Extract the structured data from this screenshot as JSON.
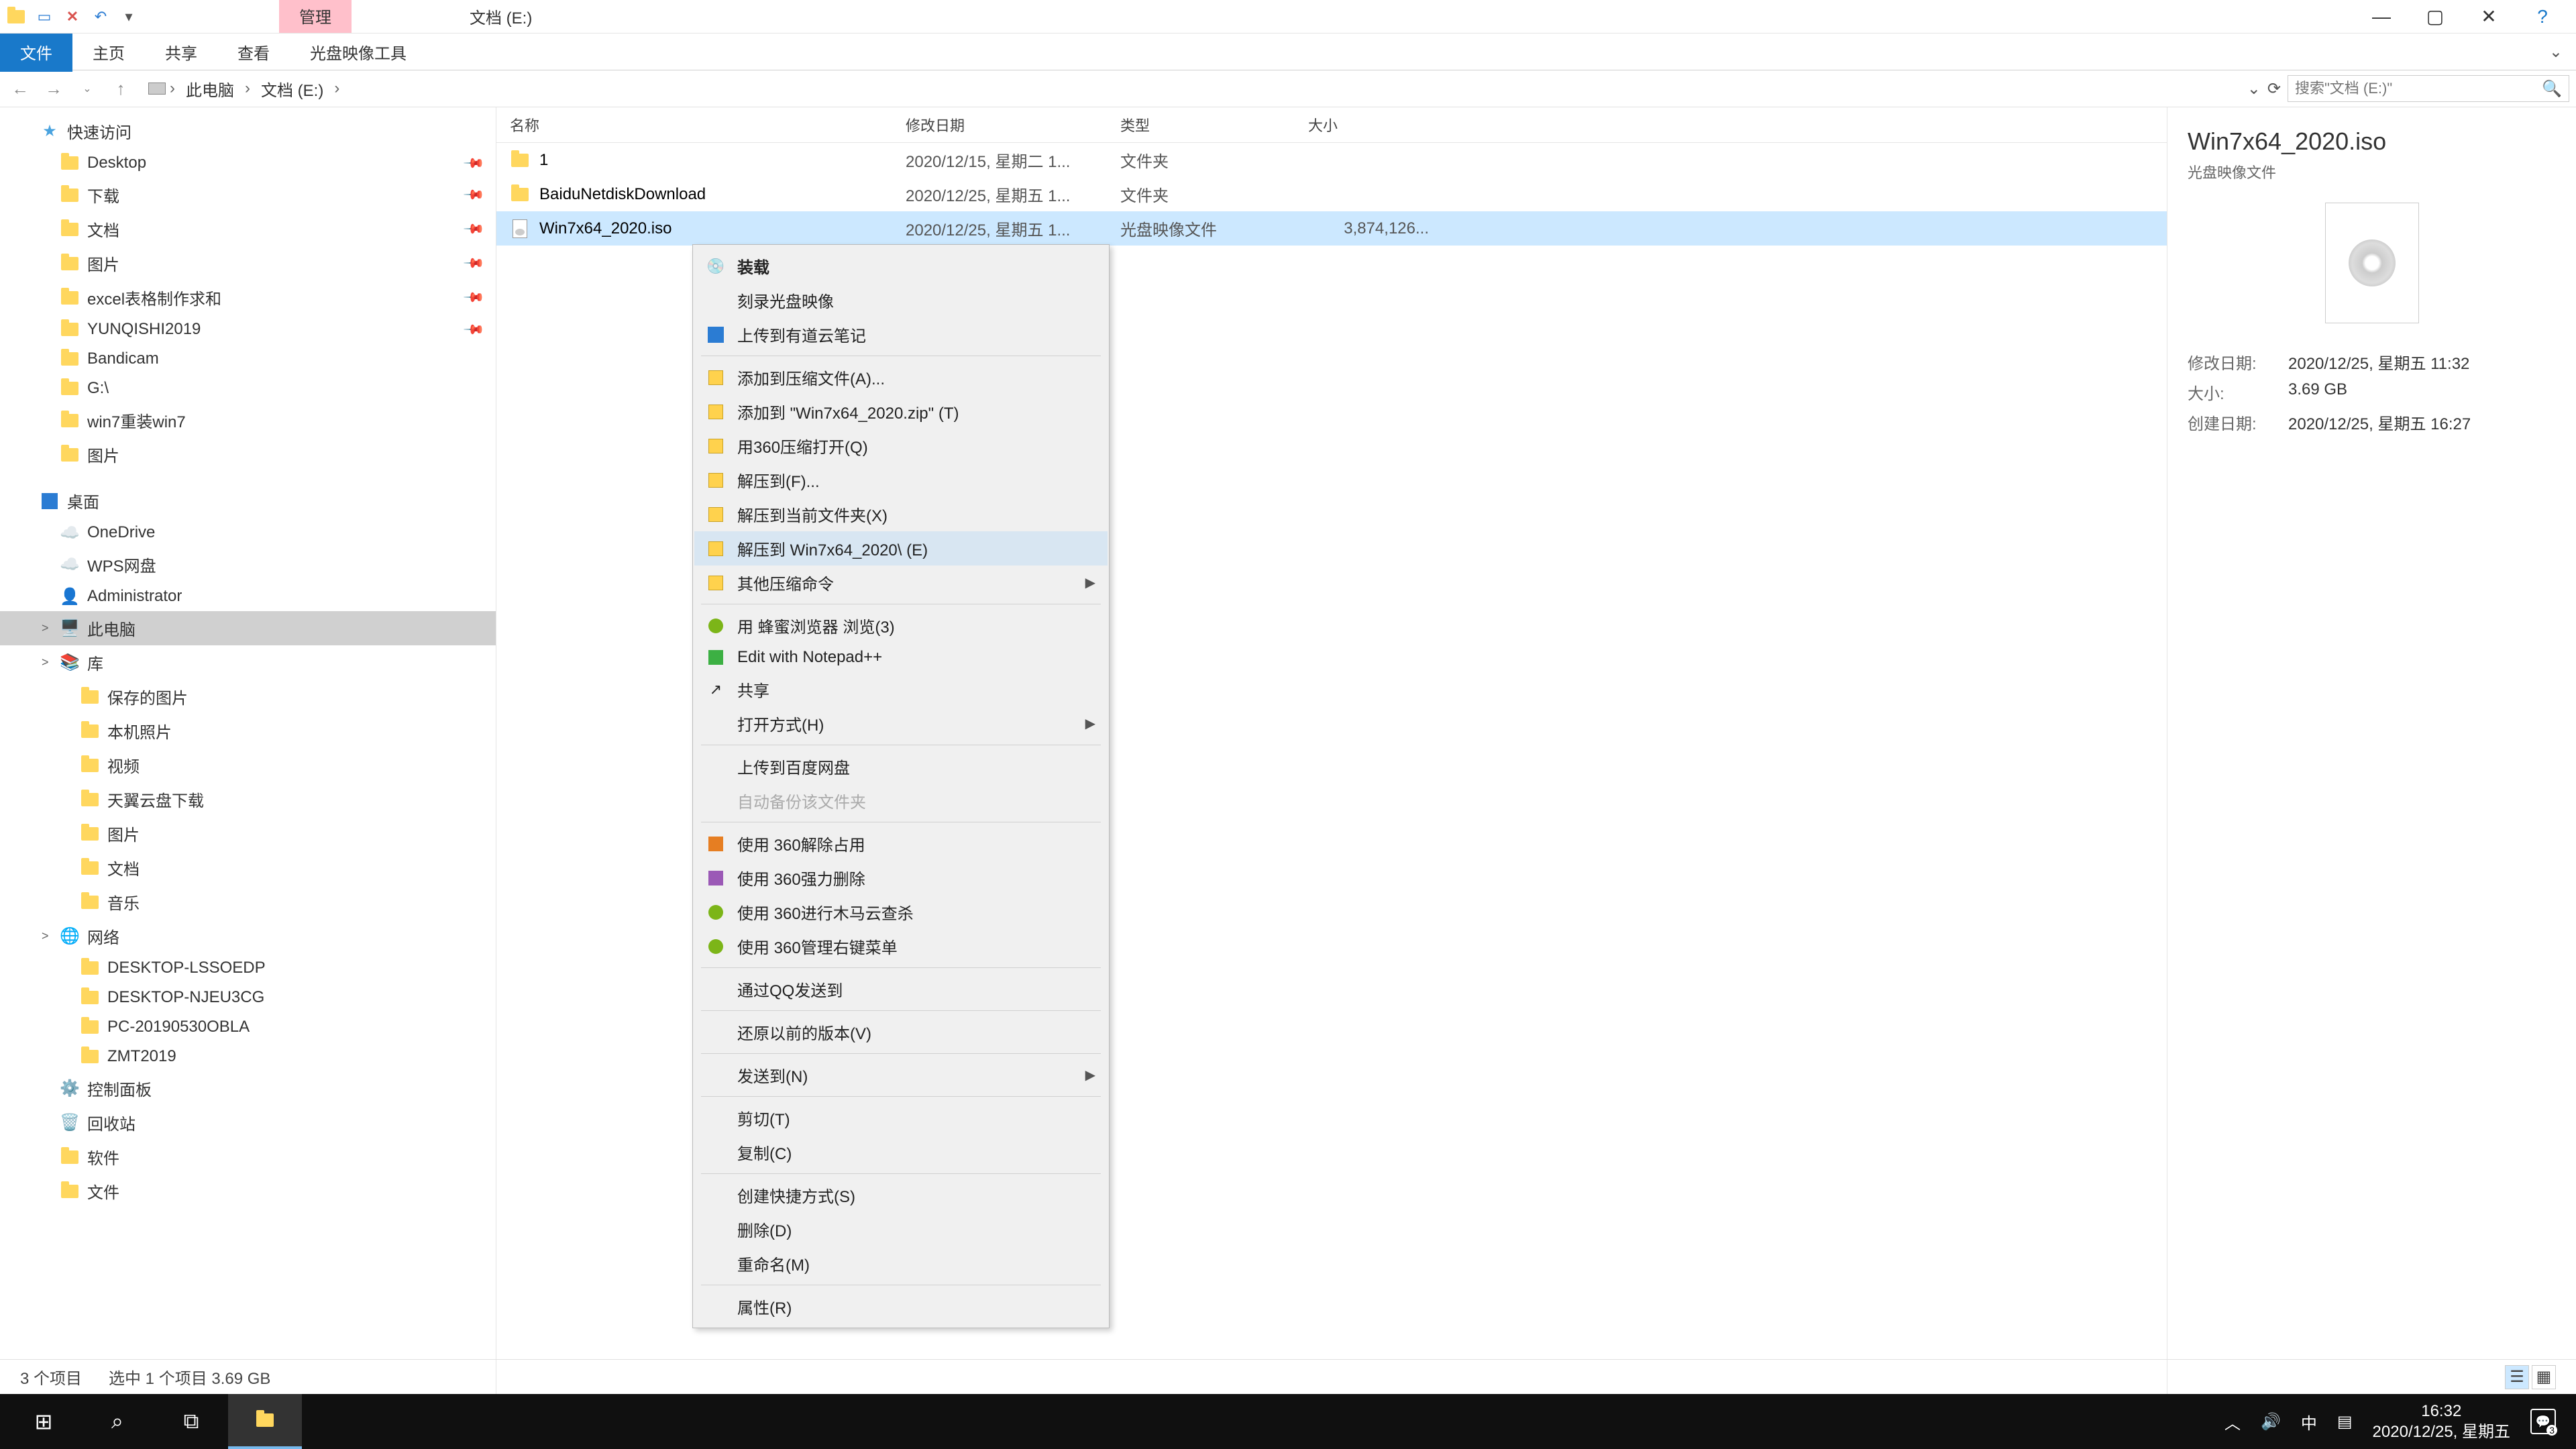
{
  "window": {
    "title": "文档 (E:)"
  },
  "ribbon_top": {
    "manage": "管理"
  },
  "ribbon": {
    "file": "文件",
    "home": "主页",
    "share": "共享",
    "view": "查看",
    "disc_tools": "光盘映像工具"
  },
  "breadcrumb": {
    "root": "此电脑",
    "current": "文档 (E:)"
  },
  "search": {
    "placeholder": "搜索\"文档 (E:)\""
  },
  "tree": {
    "quick_access": "快速访问",
    "items_qa": [
      "Desktop",
      "下载",
      "文档",
      "图片",
      "excel表格制作求和",
      "YUNQISHI2019",
      "Bandicam",
      "G:\\",
      "win7重装win7",
      "图片"
    ],
    "desktop_section": "桌面",
    "desktop_items": [
      "OneDrive",
      "WPS网盘",
      "Administrator",
      "此电脑",
      "库",
      "保存的图片",
      "本机照片",
      "视频",
      "天翼云盘下载",
      "图片",
      "文档",
      "音乐",
      "网络",
      "DESKTOP-LSSOEDP",
      "DESKTOP-NJEU3CG",
      "PC-20190530OBLA",
      "ZMT2019",
      "控制面板",
      "回收站",
      "软件",
      "文件"
    ]
  },
  "columns": {
    "name": "名称",
    "date": "修改日期",
    "type": "类型",
    "size": "大小"
  },
  "files": [
    {
      "name": "1",
      "date": "2020/12/15, 星期二 1...",
      "type": "文件夹",
      "size": "",
      "kind": "folder"
    },
    {
      "name": "BaiduNetdiskDownload",
      "date": "2020/12/25, 星期五 1...",
      "type": "文件夹",
      "size": "",
      "kind": "folder"
    },
    {
      "name": "Win7x64_2020.iso",
      "date": "2020/12/25, 星期五 1...",
      "type": "光盘映像文件",
      "size": "3,874,126...",
      "kind": "iso"
    }
  ],
  "context_menu": [
    {
      "label": "装载",
      "icon": "disc",
      "bold": true
    },
    {
      "label": "刻录光盘映像"
    },
    {
      "label": "上传到有道云笔记",
      "icon": "blue"
    },
    {
      "sep": true
    },
    {
      "label": "添加到压缩文件(A)...",
      "icon": "yellow"
    },
    {
      "label": "添加到 \"Win7x64_2020.zip\" (T)",
      "icon": "yellow"
    },
    {
      "label": "用360压缩打开(Q)",
      "icon": "yellow"
    },
    {
      "label": "解压到(F)...",
      "icon": "yellow"
    },
    {
      "label": "解压到当前文件夹(X)",
      "icon": "yellow"
    },
    {
      "label": "解压到 Win7x64_2020\\ (E)",
      "icon": "yellow",
      "hover": true
    },
    {
      "label": "其他压缩命令",
      "icon": "yellow",
      "submenu": true
    },
    {
      "sep": true
    },
    {
      "label": "用 蜂蜜浏览器 浏览(3)",
      "icon": "green-ci"
    },
    {
      "label": "Edit with Notepad++",
      "icon": "green-sq"
    },
    {
      "label": "共享",
      "icon": "share"
    },
    {
      "label": "打开方式(H)",
      "submenu": true
    },
    {
      "sep": true
    },
    {
      "label": "上传到百度网盘"
    },
    {
      "label": "自动备份该文件夹",
      "disabled": true
    },
    {
      "sep": true
    },
    {
      "label": "使用 360解除占用",
      "icon": "orange"
    },
    {
      "label": "使用 360强力删除",
      "icon": "purple"
    },
    {
      "label": "使用 360进行木马云查杀",
      "icon": "green-ci"
    },
    {
      "label": "使用 360管理右键菜单",
      "icon": "green-ci"
    },
    {
      "sep": true
    },
    {
      "label": "通过QQ发送到"
    },
    {
      "sep": true
    },
    {
      "label": "还原以前的版本(V)"
    },
    {
      "sep": true
    },
    {
      "label": "发送到(N)",
      "submenu": true
    },
    {
      "sep": true
    },
    {
      "label": "剪切(T)"
    },
    {
      "label": "复制(C)"
    },
    {
      "sep": true
    },
    {
      "label": "创建快捷方式(S)"
    },
    {
      "label": "删除(D)"
    },
    {
      "label": "重命名(M)"
    },
    {
      "sep": true
    },
    {
      "label": "属性(R)"
    }
  ],
  "details": {
    "title": "Win7x64_2020.iso",
    "subtitle": "光盘映像文件",
    "mod_label": "修改日期:",
    "mod_val": "2020/12/25, 星期五 11:32",
    "size_label": "大小:",
    "size_val": "3.69 GB",
    "create_label": "创建日期:",
    "create_val": "2020/12/25, 星期五 16:27"
  },
  "status": {
    "count": "3 个项目",
    "selected": "选中 1 个项目  3.69 GB"
  },
  "taskbar": {
    "time": "16:32",
    "date": "2020/12/25, 星期五",
    "ime": "中",
    "notif_count": "3"
  }
}
